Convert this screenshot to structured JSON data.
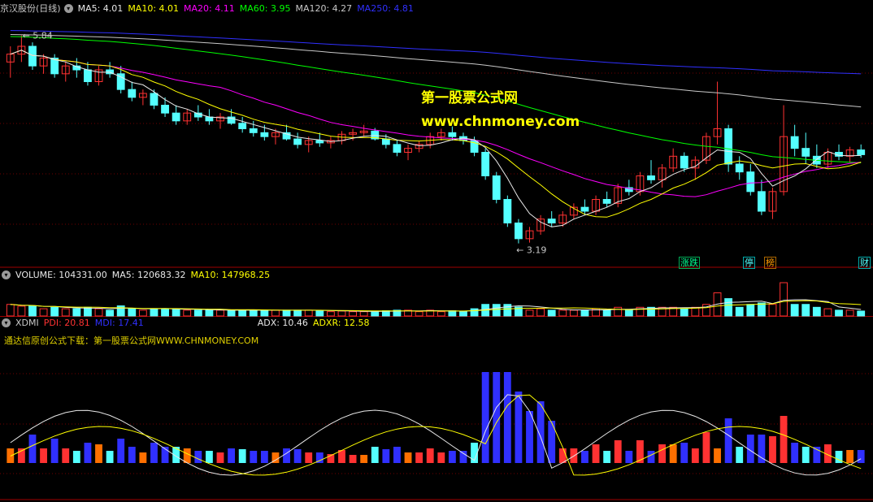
{
  "chart_data": [
    {
      "type": "candlestick",
      "title": "京汉股份(日线)",
      "indicators": [
        {
          "name": "MA5",
          "label": "MA5: 4.01",
          "color": "#e8e8e8"
        },
        {
          "name": "MA10",
          "label": "MA10: 4.01",
          "color": "#ffff00"
        },
        {
          "name": "MA20",
          "label": "MA20: 4.11",
          "color": "#ff00ff"
        },
        {
          "name": "MA60",
          "label": "MA60: 3.95",
          "color": "#00ff00"
        },
        {
          "name": "MA120",
          "label": "MA120: 4.27",
          "color": "#c8c8c8"
        },
        {
          "name": "MA250",
          "label": "MA250: 4.81",
          "color": "#3030ff"
        }
      ],
      "annotations": {
        "high": "5.84",
        "low": "3.19"
      },
      "ylim": [
        3.0,
        6.0
      ],
      "grid": true,
      "candle_colors": {
        "up": "#ff3232",
        "down": "#54ffff"
      },
      "candles": [
        [
          5.5,
          5.7,
          5.3,
          5.6
        ],
        [
          5.6,
          5.84,
          5.5,
          5.7
        ],
        [
          5.7,
          5.75,
          5.4,
          5.45
        ],
        [
          5.45,
          5.6,
          5.35,
          5.55
        ],
        [
          5.55,
          5.6,
          5.3,
          5.35
        ],
        [
          5.35,
          5.5,
          5.25,
          5.45
        ],
        [
          5.45,
          5.55,
          5.3,
          5.4
        ],
        [
          5.4,
          5.5,
          5.2,
          5.25
        ],
        [
          5.25,
          5.45,
          5.2,
          5.4
        ],
        [
          5.4,
          5.5,
          5.3,
          5.35
        ],
        [
          5.35,
          5.45,
          5.1,
          5.15
        ],
        [
          5.15,
          5.25,
          5.0,
          5.05
        ],
        [
          5.05,
          5.15,
          4.95,
          5.1
        ],
        [
          5.1,
          5.15,
          4.9,
          4.95
        ],
        [
          4.95,
          5.05,
          4.8,
          4.85
        ],
        [
          4.85,
          4.95,
          4.7,
          4.75
        ],
        [
          4.75,
          4.9,
          4.7,
          4.85
        ],
        [
          4.85,
          4.95,
          4.75,
          4.8
        ],
        [
          4.8,
          4.9,
          4.7,
          4.75
        ],
        [
          4.75,
          4.85,
          4.65,
          4.8
        ],
        [
          4.8,
          4.9,
          4.7,
          4.72
        ],
        [
          4.72,
          4.8,
          4.6,
          4.65
        ],
        [
          4.65,
          4.75,
          4.55,
          4.6
        ],
        [
          4.6,
          4.7,
          4.5,
          4.55
        ],
        [
          4.55,
          4.65,
          4.45,
          4.6
        ],
        [
          4.6,
          4.7,
          4.5,
          4.52
        ],
        [
          4.52,
          4.6,
          4.4,
          4.45
        ],
        [
          4.45,
          4.55,
          4.35,
          4.5
        ],
        [
          4.5,
          4.6,
          4.42,
          4.47
        ],
        [
          4.47,
          4.55,
          4.4,
          4.5
        ],
        [
          4.5,
          4.62,
          4.45,
          4.58
        ],
        [
          4.58,
          4.65,
          4.5,
          4.6
        ],
        [
          4.6,
          4.7,
          4.55,
          4.62
        ],
        [
          4.62,
          4.66,
          4.5,
          4.52
        ],
        [
          4.52,
          4.58,
          4.4,
          4.45
        ],
        [
          4.45,
          4.5,
          4.3,
          4.35
        ],
        [
          4.35,
          4.45,
          4.25,
          4.4
        ],
        [
          4.4,
          4.5,
          4.35,
          4.45
        ],
        [
          4.45,
          4.6,
          4.4,
          4.55
        ],
        [
          4.55,
          4.65,
          4.5,
          4.6
        ],
        [
          4.6,
          4.68,
          4.5,
          4.55
        ],
        [
          4.55,
          4.6,
          4.45,
          4.5
        ],
        [
          4.5,
          4.55,
          4.3,
          4.35
        ],
        [
          4.35,
          4.4,
          4.0,
          4.05
        ],
        [
          4.05,
          4.1,
          3.7,
          3.75
        ],
        [
          3.75,
          3.8,
          3.4,
          3.45
        ],
        [
          3.45,
          3.5,
          3.19,
          3.25
        ],
        [
          3.25,
          3.4,
          3.2,
          3.35
        ],
        [
          3.35,
          3.55,
          3.3,
          3.5
        ],
        [
          3.5,
          3.6,
          3.4,
          3.45
        ],
        [
          3.45,
          3.6,
          3.4,
          3.55
        ],
        [
          3.55,
          3.7,
          3.5,
          3.65
        ],
        [
          3.65,
          3.75,
          3.55,
          3.6
        ],
        [
          3.6,
          3.8,
          3.55,
          3.75
        ],
        [
          3.75,
          3.85,
          3.65,
          3.7
        ],
        [
          3.7,
          3.95,
          3.65,
          3.9
        ],
        [
          3.9,
          4.0,
          3.8,
          3.85
        ],
        [
          3.85,
          4.1,
          3.8,
          4.05
        ],
        [
          4.05,
          4.25,
          3.95,
          4.0
        ],
        [
          4.0,
          4.2,
          3.9,
          4.15
        ],
        [
          4.15,
          4.4,
          4.1,
          4.3
        ],
        [
          4.3,
          4.35,
          4.1,
          4.15
        ],
        [
          4.15,
          4.3,
          4.0,
          4.25
        ],
        [
          4.25,
          4.6,
          4.2,
          4.55
        ],
        [
          4.55,
          5.25,
          4.45,
          4.65
        ],
        [
          4.65,
          4.7,
          4.1,
          4.2
        ],
        [
          4.2,
          4.3,
          4.0,
          4.1
        ],
        [
          4.1,
          4.2,
          3.8,
          3.85
        ],
        [
          3.85,
          4.0,
          3.55,
          3.6
        ],
        [
          3.6,
          3.9,
          3.5,
          3.85
        ],
        [
          3.85,
          4.95,
          3.8,
          4.55
        ],
        [
          4.55,
          4.7,
          4.3,
          4.4
        ],
        [
          4.4,
          4.6,
          4.2,
          4.3
        ],
        [
          4.3,
          4.45,
          4.15,
          4.2
        ],
        [
          4.2,
          4.4,
          4.15,
          4.35
        ],
        [
          4.35,
          4.45,
          4.25,
          4.3
        ],
        [
          4.3,
          4.42,
          4.22,
          4.38
        ],
        [
          4.38,
          4.45,
          4.28,
          4.32
        ]
      ]
    },
    {
      "type": "bar",
      "title": "VOLUME: 104331.00",
      "indicators": [
        {
          "name": "MA5",
          "label": "MA5: 120683.32",
          "color": "#e8e8e8"
        },
        {
          "name": "MA10",
          "label": "MA10: 147968.25",
          "color": "#ffff00"
        }
      ],
      "label": "VOLUME",
      "value_label": "VOLUME: 104331.00"
    },
    {
      "type": "bar",
      "title": "XDMI",
      "indicators": [
        {
          "name": "PDI",
          "label": "PDI: 20.81",
          "color": "#ff3232"
        },
        {
          "name": "MDI",
          "label": "MDI: 17.41",
          "color": "#3030ff"
        },
        {
          "name": "ADX",
          "label": "ADX: 10.46",
          "color": "#e8e8e8"
        },
        {
          "name": "ADXR",
          "label": "ADXR: 12.58",
          "color": "#ffff00"
        }
      ],
      "promo_text": "通达信原创公式下载：第一股票公式网WWW.CHNMONEY.COM"
    }
  ],
  "watermark": {
    "line1": "第一股票公式网",
    "line2": "www.chnmoney.com"
  },
  "flags": [
    {
      "text": "涨跌",
      "color": "#00ff90"
    },
    {
      "text": "停",
      "color": "#54ffff"
    },
    {
      "text": "榜",
      "color": "#ff9900"
    },
    {
      "text": "财",
      "color": "#54ffff"
    }
  ],
  "icons": {
    "panel_menu": "chevron-down-icon"
  }
}
